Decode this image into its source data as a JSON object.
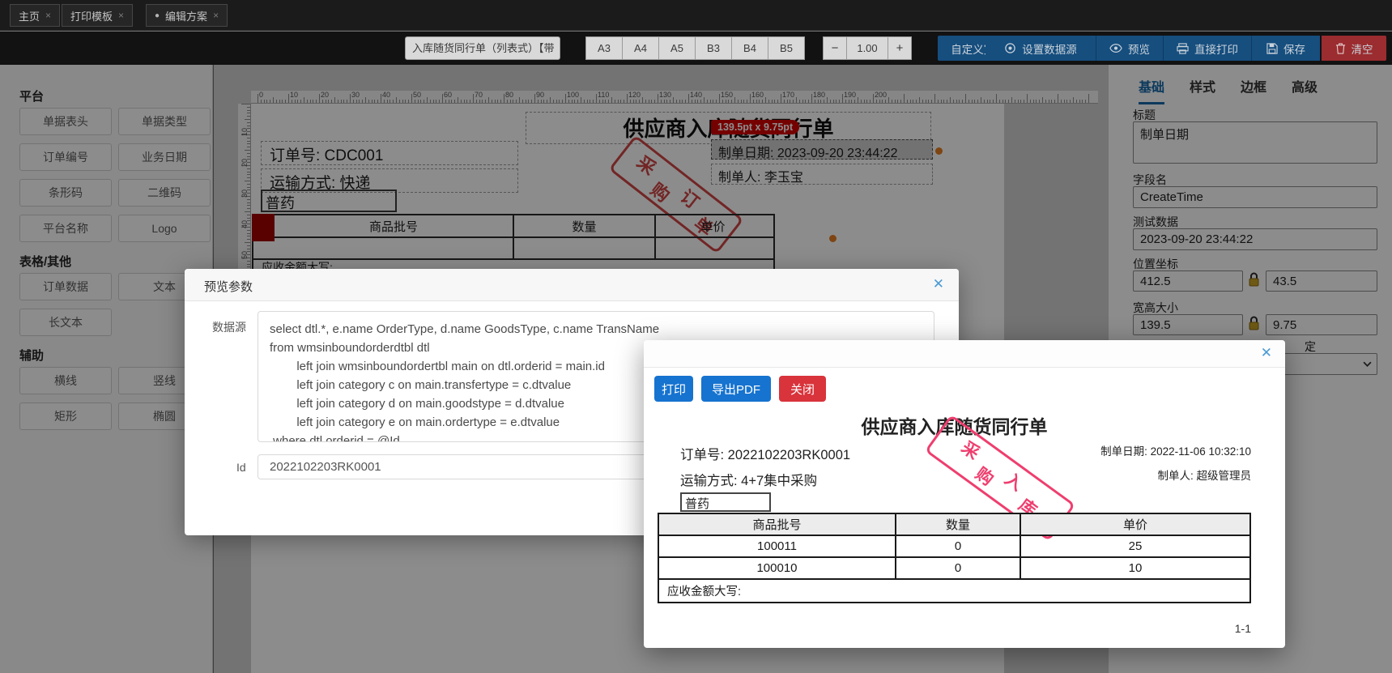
{
  "tabbar": {
    "close_glyph": "×",
    "active_dot": "●",
    "tabs": [
      {
        "label": "主页"
      },
      {
        "label": "打印模板"
      },
      {
        "label": "编辑方案"
      }
    ]
  },
  "toolbar": {
    "template_name": "入库随货同行单（列表式）【带",
    "paper_sizes": [
      "A3",
      "A4",
      "A5",
      "B3",
      "B4",
      "B5"
    ],
    "zoom_out": "−",
    "zoom_value": "1.00",
    "zoom_in": "+",
    "custom_size": "自定义宽高",
    "set_datasource": "设置数据源",
    "preview": "预览",
    "direct_print": "直接打印",
    "save": "保存",
    "clear": "清空"
  },
  "sidebar": {
    "sections": [
      {
        "title": "平台",
        "items": [
          "单据表头",
          "单据类型",
          "订单编号",
          "业务日期",
          "条形码",
          "二维码",
          "平台名称",
          "Logo"
        ]
      },
      {
        "title": "表格/其他",
        "items": [
          "订单数据",
          "文本",
          "长文本"
        ]
      },
      {
        "title": "辅助",
        "items": [
          "横线",
          "竖线",
          "矩形",
          "椭圆"
        ]
      }
    ]
  },
  "canvas": {
    "ruler_h_labels": [
      "0",
      "10",
      "20",
      "30",
      "40",
      "50",
      "60",
      "70",
      "80",
      "90",
      "100",
      "110",
      "120",
      "130",
      "140",
      "150",
      "160",
      "170",
      "180",
      "190",
      "200"
    ],
    "ruler_v_labels": [
      "10",
      "20",
      "30",
      "40",
      "50"
    ],
    "doc_title": "供应商入库随货同行单",
    "order_no": "订单号: CDC001",
    "transport": "运输方式: 快递",
    "drug_type": "普药",
    "size_tooltip": "139.5pt x 9.75pt",
    "created_date": "制单日期: 2023-09-20 23:44:22",
    "created_by": "制单人: 李玉宝",
    "stamp_text": "采购订单",
    "table_headers": [
      "商品批号",
      "数量",
      "单价"
    ],
    "table_footer": "应收金额大写:"
  },
  "properties": {
    "tabs": [
      "基础",
      "样式",
      "边框",
      "高级"
    ],
    "title_label": "标题",
    "title_value": "制单日期",
    "field_label": "字段名",
    "field_value": "CreateTime",
    "test_label": "测试数据",
    "test_value": "2023-09-20 23:44:22",
    "pos_label": "位置坐标",
    "pos_x": "412.5",
    "pos_y": "43.5",
    "size_label": "宽高大小",
    "size_w": "139.5",
    "size_h": "9.75",
    "partial_label": "定"
  },
  "preview_params": {
    "title": "预览参数",
    "close_glyph": "✕",
    "datasource_label": "数据源",
    "sql_lines": [
      "select dtl.*, e.name OrderType, d.name GoodsType, c.name TransName",
      "from wmsinboundorderdtbl dtl",
      "        left join wmsinboundordertbl main on dtl.orderid = main.id",
      "        left join category c on main.transfertype = c.dtvalue",
      "        left join category d on main.goodstype = d.dtvalue",
      "        left join category e on main.ordertype = e.dtvalue",
      " where dtl.orderid = @Id"
    ],
    "id_label": "Id",
    "id_value": "2022102203RK0001"
  },
  "print_preview": {
    "close_glyph": "✕",
    "print_btn": "打印",
    "export_btn": "导出PDF",
    "close_btn": "关闭",
    "doc": {
      "title": "供应商入库随货同行单",
      "order_no": "订单号: 2022102203RK0001",
      "transport": "运输方式: 4+7集中采购",
      "drug_type": "普药",
      "created_date": "制单日期: 2022-11-06 10:32:10",
      "created_by": "制单人: 超级管理员",
      "stamp_text": "采购入库",
      "table": {
        "headers": [
          "商品批号",
          "数量",
          "单价"
        ],
        "rows": [
          [
            "100011",
            "0",
            "25"
          ],
          [
            "100010",
            "0",
            "10"
          ]
        ],
        "footer": "应收金额大写:"
      },
      "page": "1-1"
    }
  },
  "colors": {
    "toolbar_blue": "#164e7e",
    "toolbar_red": "#9b2c2f",
    "accent_blue": "#1673d0",
    "danger_red": "#d9333b",
    "tab_active_blue": "#1769aa",
    "tooltip_red": "#d60000",
    "stamp_canvas": "#cf4444",
    "stamp_preview": "#ef3e6e",
    "handle_orange": "#e67e22"
  }
}
